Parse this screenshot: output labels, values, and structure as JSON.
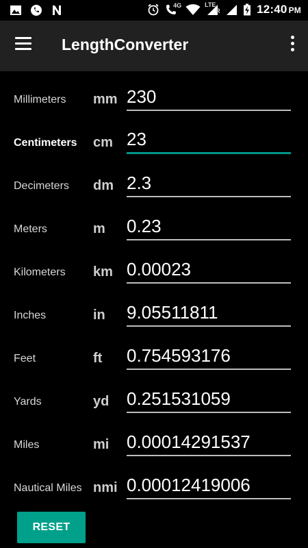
{
  "status_bar": {
    "time": "12:40",
    "ampm": "PM",
    "network_4g": "4G",
    "network_lte": "LTE",
    "roaming": "R",
    "left_icons": [
      "image-icon",
      "whatsapp-icon",
      "n-logo-icon"
    ],
    "right_icons": [
      "alarm-icon",
      "wifi-calling-icon",
      "wifi-icon",
      "signal-icon",
      "signal-icon",
      "battery-charging-icon"
    ]
  },
  "app_bar": {
    "title": "LengthConverter",
    "menu_icon": "hamburger-icon",
    "overflow_icon": "more-vert-icon"
  },
  "units": [
    {
      "name": "Millimeters",
      "symbol": "mm",
      "value": "230",
      "focused": false
    },
    {
      "name": "Centimeters",
      "symbol": "cm",
      "value": "23",
      "focused": true
    },
    {
      "name": "Decimeters",
      "symbol": "dm",
      "value": "2.3",
      "focused": false
    },
    {
      "name": "Meters",
      "symbol": "m",
      "value": "0.23",
      "focused": false
    },
    {
      "name": "Kilometers",
      "symbol": "km",
      "value": "0.00023",
      "focused": false
    },
    {
      "name": "Inches",
      "symbol": "in",
      "value": "9.05511811",
      "focused": false
    },
    {
      "name": "Feet",
      "symbol": "ft",
      "value": "0.754593176",
      "focused": false
    },
    {
      "name": "Yards",
      "symbol": "yd",
      "value": "0.251531059",
      "focused": false
    },
    {
      "name": "Miles",
      "symbol": "mi",
      "value": "0.00014291537",
      "focused": false
    },
    {
      "name": "Nautical Miles",
      "symbol": "nmi",
      "value": "0.00012419006",
      "focused": false
    }
  ],
  "reset_label": "RESET",
  "colors": {
    "accent": "#009688",
    "button": "#00a08a",
    "app_bar": "#212121",
    "background": "#000000"
  }
}
